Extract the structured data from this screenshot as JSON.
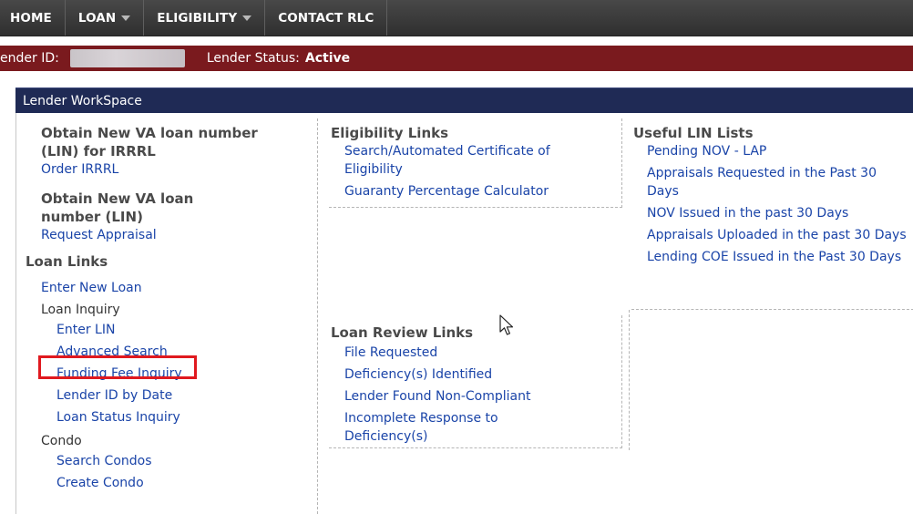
{
  "nav": {
    "home": "HOME",
    "loan": "LOAN",
    "eligibility": "ELIGIBILITY",
    "contact": "CONTACT RLC"
  },
  "status": {
    "lender_id_label": "ender ID:",
    "lender_status_label": "Lender Status:",
    "lender_status_value": "Active"
  },
  "workspace": {
    "title": "Lender WorkSpace"
  },
  "col1": {
    "irrrl_heading": "Obtain New VA loan number (LIN) for IRRRL",
    "irrrl_link": "Order IRRRL",
    "lin_heading": "Obtain New VA loan number (LIN)",
    "lin_link": "Request Appraisal",
    "loan_links_heading": "Loan Links",
    "enter_new_loan": "Enter New Loan",
    "loan_inquiry": "Loan Inquiry",
    "enter_lin": "Enter LIN",
    "advanced_search": "Advanced Search",
    "funding_fee_inquiry": "Funding Fee Inquiry",
    "lender_id_by_date": "Lender ID by Date",
    "loan_status_inquiry": "Loan Status Inquiry",
    "condo": "Condo",
    "search_condos": "Search Condos",
    "create_condo": "Create Condo"
  },
  "col2": {
    "eligibility_heading": "Eligibility Links",
    "search_coe": "Search/Automated Certificate of Eligibility",
    "guaranty_calc": "Guaranty Percentage Calculator",
    "review_heading": "Loan Review Links",
    "file_requested": "File Requested",
    "deficiency_identified": "Deficiency(s) Identified",
    "lender_non_compliant": "Lender Found Non-Compliant",
    "incomplete_response": "Incomplete Response to Deficiency(s)"
  },
  "col3": {
    "heading": "Useful LIN Lists",
    "pending_nov": "Pending NOV - LAP",
    "appraisals_requested": "Appraisals Requested in the Past 30 Days",
    "nov_issued": "NOV Issued in the past 30 Days",
    "appraisals_uploaded": "Appraisals Uploaded in the past 30 Days",
    "lending_coe": "Lending COE Issued in the Past 30 Days"
  },
  "colors": {
    "nav_bg": "#3a3a3a",
    "status_bar_bg": "#7a1a1e",
    "workspace_header_bg": "#1f2a55",
    "link": "#1a44a8",
    "highlight": "#e0191f"
  }
}
